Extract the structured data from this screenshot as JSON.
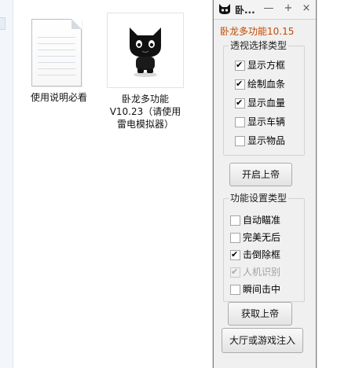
{
  "desktop": {
    "files": [
      {
        "label": "使用说明必看",
        "icon": "text-document-icon"
      },
      {
        "label": "卧龙多功能V10.23（请使用雷电模拟器）",
        "icon": "black-cat-app-icon"
      }
    ]
  },
  "panel": {
    "title": "卧...",
    "title_icon": "black-cat-icon",
    "buttons": {
      "minimize": "—",
      "maximize": "+",
      "close": "×"
    },
    "version": "卧龙多功能10.15",
    "version_color": "#c04a00",
    "esp_group": {
      "title": "透视选择类型",
      "options": [
        {
          "label": "显示方框",
          "checked": true
        },
        {
          "label": "绘制血条",
          "checked": true
        },
        {
          "label": "显示血量",
          "checked": true
        },
        {
          "label": "显示车辆",
          "checked": false
        },
        {
          "label": "显示物品",
          "checked": false
        }
      ]
    },
    "start_button": "开启上帝",
    "func_group": {
      "title": "功能设置类型",
      "options": [
        {
          "label": "自动瞄准",
          "checked": false,
          "disabled": false
        },
        {
          "label": "完美无后",
          "checked": false,
          "disabled": false
        },
        {
          "label": "击倒除框",
          "checked": true,
          "disabled": false
        },
        {
          "label": "人机识别",
          "checked": true,
          "disabled": true
        },
        {
          "label": "瞬间击中",
          "checked": false,
          "disabled": false
        }
      ]
    },
    "get_button": "获取上帝",
    "inject_button": "大厅或游戏注入"
  }
}
